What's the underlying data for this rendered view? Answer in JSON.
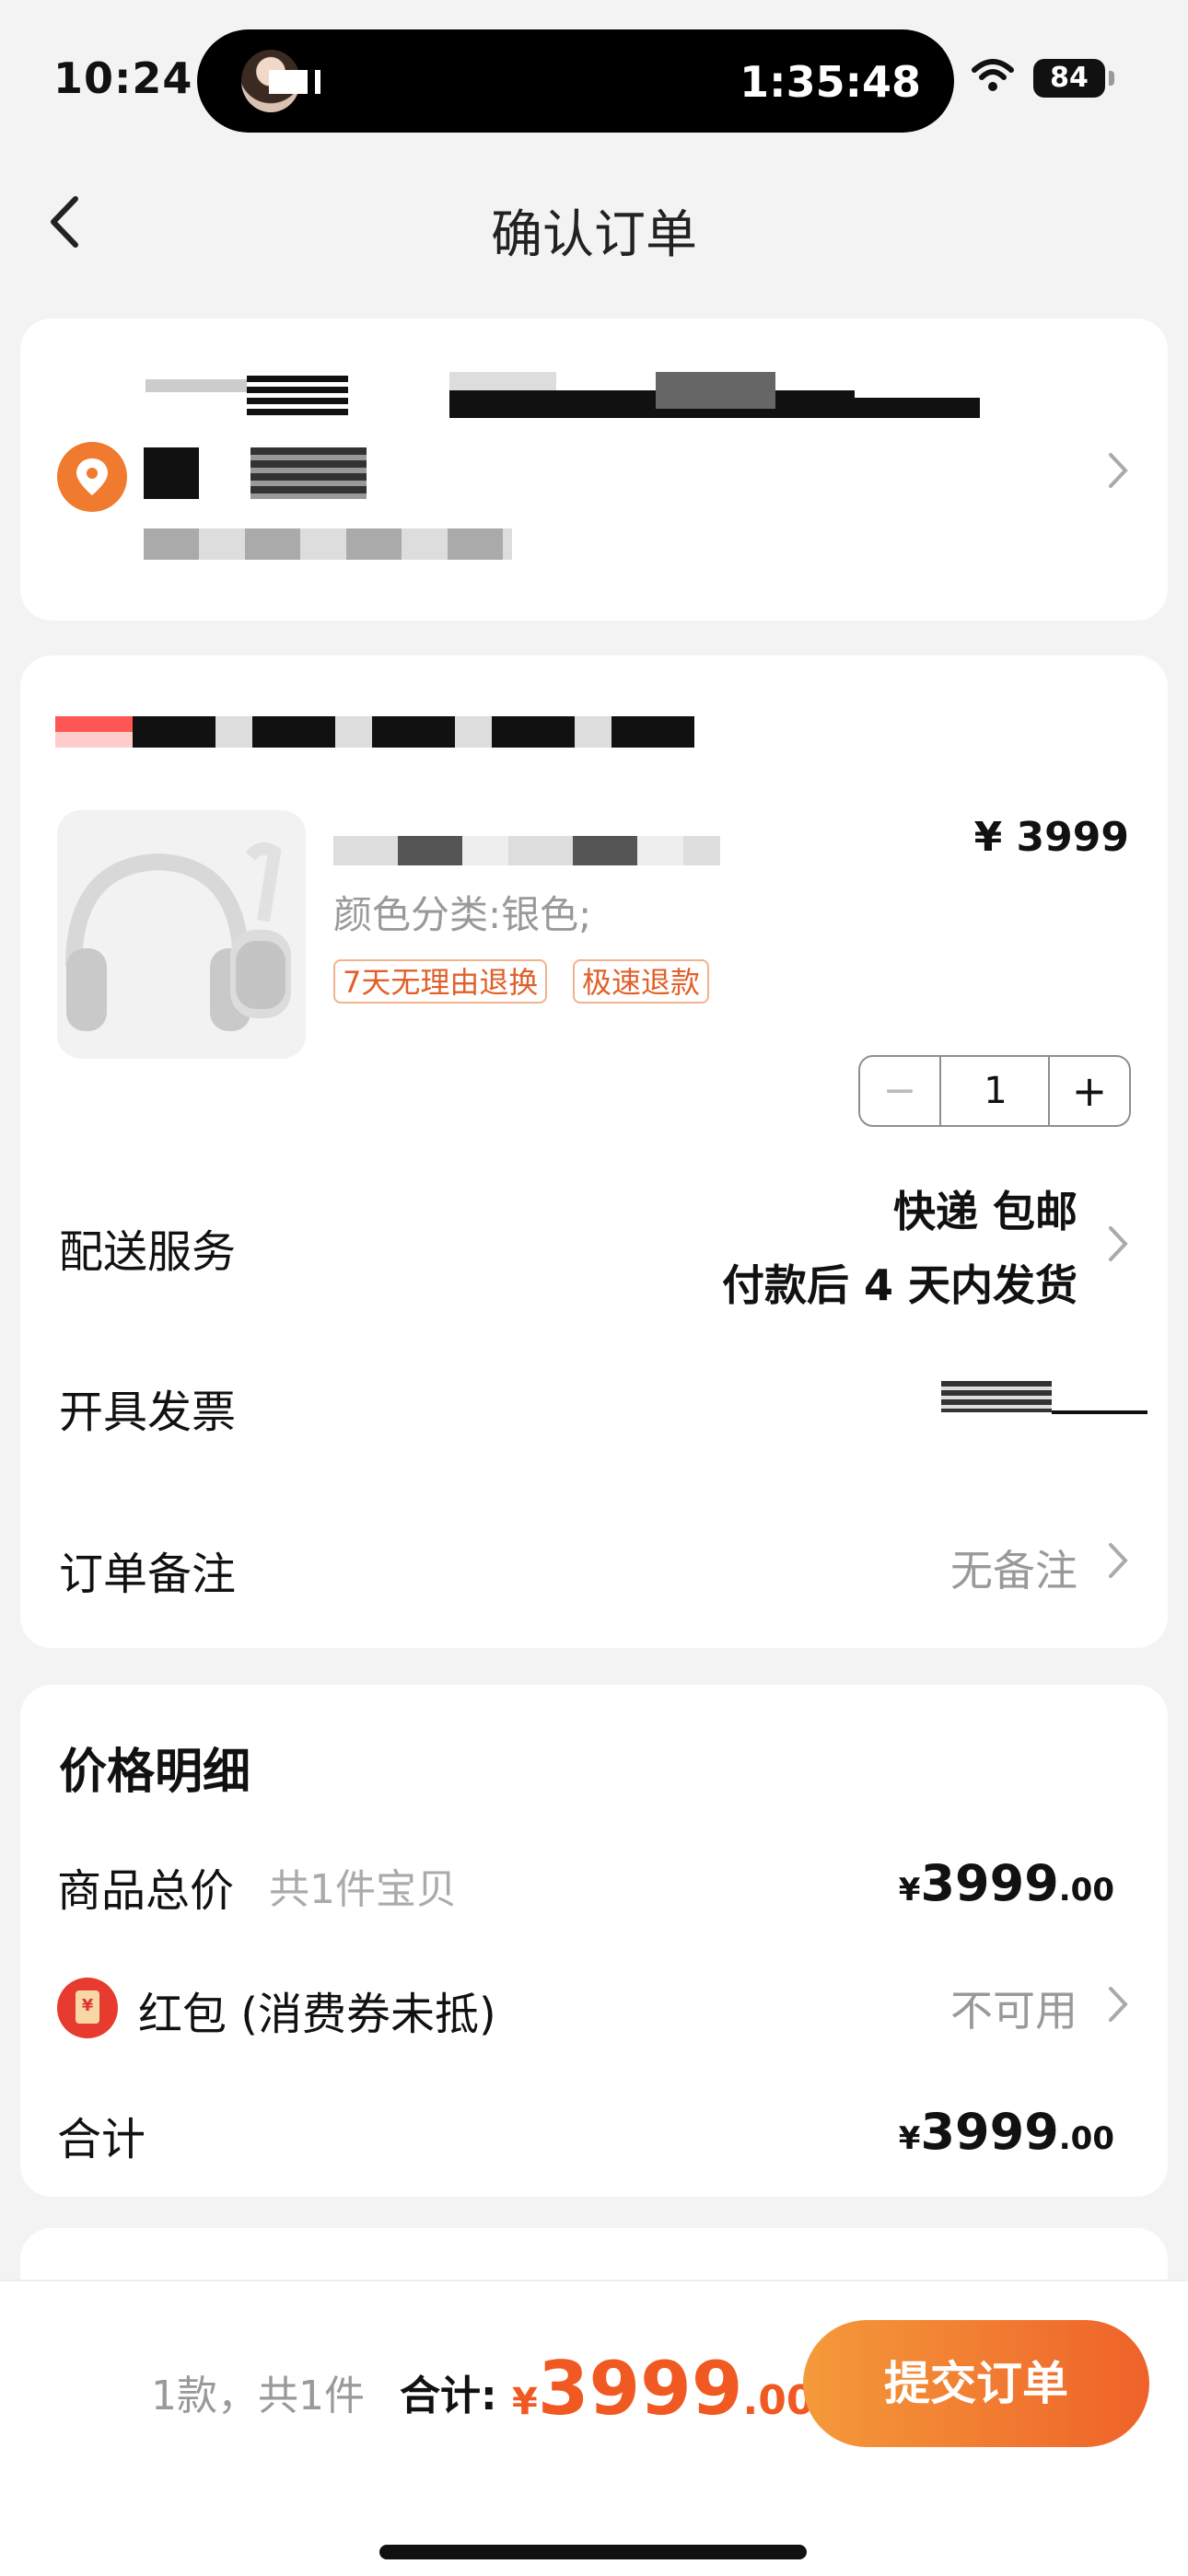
{
  "status": {
    "time": "10:24",
    "timer": "1:35:48",
    "battery": "84"
  },
  "nav": {
    "title": "确认订单"
  },
  "product": {
    "sku": "颜色分类:银色;",
    "tags": [
      "7天无理由退换",
      "极速退款"
    ],
    "price": "¥ 3999",
    "quantity": "1",
    "minus": "−",
    "plus": "+"
  },
  "rows": {
    "delivery_label": "配送服务",
    "delivery_value": "快递 包邮",
    "delivery_note": "付款后 4 天内发货",
    "invoice_label": "开具发票",
    "remark_label": "订单备注",
    "remark_value": "无备注"
  },
  "price_detail": {
    "title": "价格明细",
    "goods_label": "商品总价",
    "goods_count": "共1件宝贝",
    "goods_currency": "¥",
    "goods_int": "3999",
    "goods_dec": ".00",
    "redpack_label": "红包 (消费券未抵)",
    "redpack_value": "不可用",
    "total_label": "合计",
    "total_currency": "¥",
    "total_int": "3999",
    "total_dec": ".00"
  },
  "bottom": {
    "summary": "1款，共1件",
    "sum_label": "合计:",
    "currency": "¥",
    "int": "3999",
    "dec": ".00",
    "submit": "提交订单"
  },
  "colors": {
    "accent": "#f05a22",
    "location": "#f07a2d",
    "redpack": "#e63b2e"
  }
}
